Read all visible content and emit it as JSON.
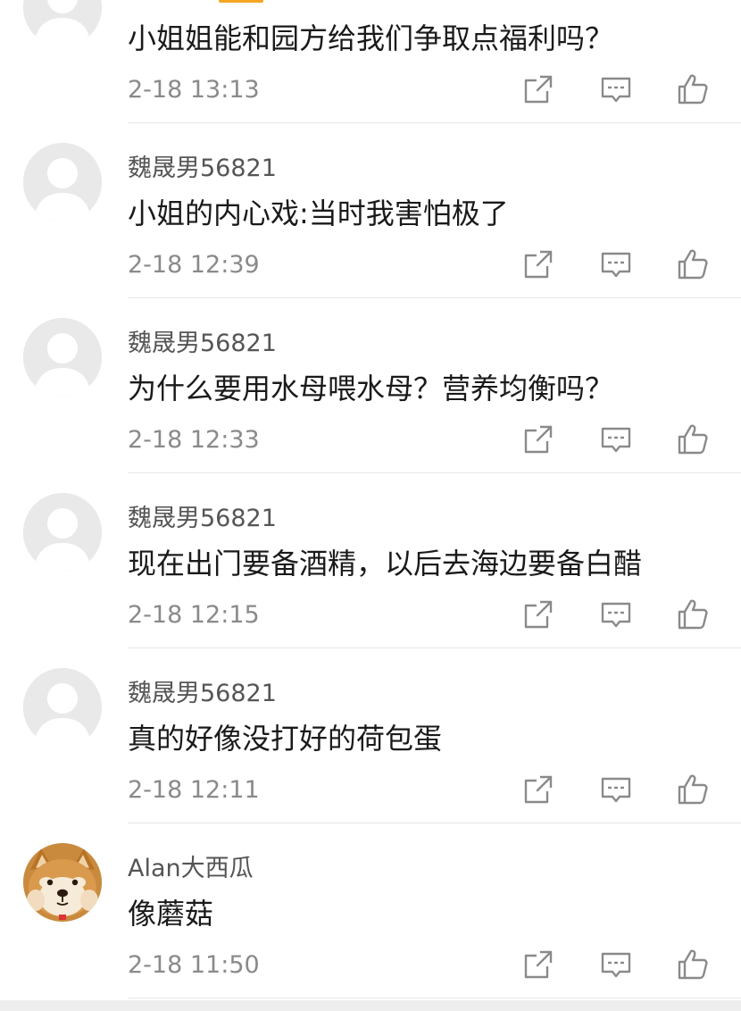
{
  "colors": {
    "accent": "#f5a623",
    "username": "#555555",
    "text": "#1a1a1a",
    "time": "#8a8a8a",
    "icon": "#8a8a8a",
    "divider": "#e6e6e6"
  },
  "comments": [
    {
      "username": "",
      "text": "小姐姐能和园方给我们争取点福利吗？",
      "time": "2-18 13:13",
      "avatar": "default-avatar"
    },
    {
      "username": "魏晟男56821",
      "text": "小姐的内心戏:当时我害怕极了",
      "time": "2-18 12:39",
      "avatar": "default-avatar"
    },
    {
      "username": "魏晟男56821",
      "text": "为什么要用水母喂水母？营养均衡吗？",
      "time": "2-18 12:33",
      "avatar": "default-avatar"
    },
    {
      "username": "魏晟男56821",
      "text": "现在出门要备酒精，以后去海边要备白醋",
      "time": "2-18 12:15",
      "avatar": "default-avatar"
    },
    {
      "username": "魏晟男56821",
      "text": "真的好像没打好的荷包蛋",
      "time": "2-18 12:11",
      "avatar": "default-avatar"
    },
    {
      "username": "Alan大西瓜",
      "text": "像蘑菇",
      "time": "2-18 11:50",
      "avatar": "shiba-dog-avatar"
    }
  ],
  "icons": {
    "share": "share-icon",
    "reply": "comment-icon",
    "like": "thumbs-up-icon"
  }
}
